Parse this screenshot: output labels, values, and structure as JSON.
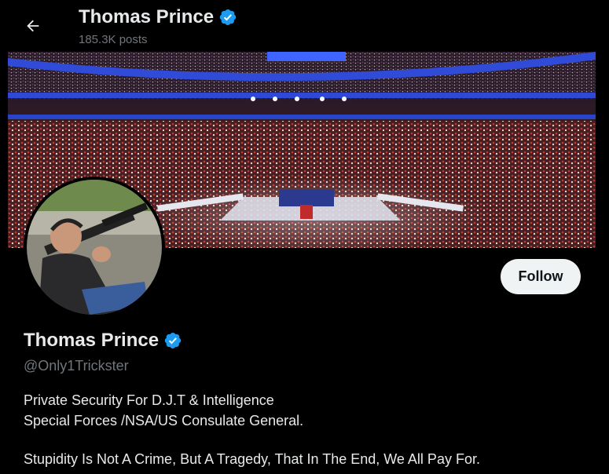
{
  "header": {
    "title": "Thomas Prince",
    "posts_count": "185.3K posts"
  },
  "profile": {
    "name": "Thomas Prince",
    "handle": "@Only1Trickster",
    "follow_label": "Follow",
    "bio_lines": [
      "Private Security For D.J.T & Intelligence",
      "Special Forces /NSA/US Consulate General.",
      "Stupidity Is Not A Crime, But A Tragedy, That In The End, We All Pay For."
    ]
  },
  "icons": {
    "back": "arrow-left-icon",
    "verified": "verified-badge-icon"
  },
  "colors": {
    "background": "#000000",
    "verified_blue": "#1d9bf0",
    "muted_text": "#71767b",
    "follow_bg": "#eff3f4"
  }
}
